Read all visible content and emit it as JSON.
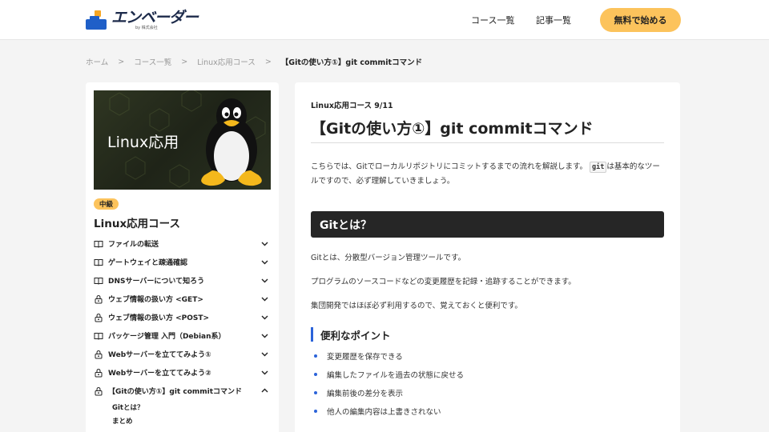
{
  "header": {
    "logo_name": "エンベーダー",
    "logo_sub": "by 株式会社",
    "nav": [
      "コース一覧",
      "記事一覧"
    ],
    "cta_label": "無料で始める"
  },
  "breadcrumb": {
    "items": [
      "ホーム",
      "コース一覧",
      "Linux応用コース"
    ],
    "separator": ">",
    "current": "【Gitの使い方①】git commitコマンド"
  },
  "sidebar": {
    "banner_title": "Linux応用",
    "level": "中級",
    "course_title": "Linux応用コース",
    "lessons": [
      {
        "label": "ファイルの転送",
        "icon": "book-icon"
      },
      {
        "label": "ゲートウェイと疎通確認",
        "icon": "book-icon"
      },
      {
        "label": "DNSサーバーについて知ろう",
        "icon": "book-icon"
      },
      {
        "label": "ウェブ情報の扱い方 <GET>",
        "icon": "lock-icon"
      },
      {
        "label": "ウェブ情報の扱い方 <POST>",
        "icon": "lock-icon"
      },
      {
        "label": "パッケージ管理 入門（Debian系）",
        "icon": "book-icon"
      },
      {
        "label": "Webサーバーを立ててみよう①",
        "icon": "lock-icon"
      },
      {
        "label": "Webサーバーを立ててみよう②",
        "icon": "lock-icon"
      },
      {
        "label": "【Gitの使い方①】git commitコマンド",
        "icon": "lock-icon",
        "expanded": true
      }
    ],
    "sub_items": [
      "Gitとは？",
      "まとめ"
    ]
  },
  "main": {
    "course_progress": "Linux応用コース  9/11",
    "title": "【Gitの使い方①】git commitコマンド",
    "intro_before": "こちらでは、Gitでローカルリポジトリにコミットするまでの流れを解説します。",
    "intro_code": "git",
    "intro_after": "は基本的なツールですので、必ず理解していきましょう。",
    "section_heading": "Gitとは？",
    "paragraphs": [
      "Gitとは、分散型バージョン管理ツールです。",
      "プログラムのソースコードなどの変更履歴を記録・追跡することができます。",
      "集団開発ではほぼ必ず利用するので、覚えておくと便利です。"
    ],
    "subheading": "便利なポイント",
    "bullets": [
      "変更履歴を保存できる",
      "編集したファイルを過去の状態に戻せる",
      "編集前後の差分を表示",
      "他人の編集内容は上書きされない"
    ]
  },
  "colors": {
    "accent_yellow": "#fcc35c",
    "accent_blue": "#2b63d9",
    "heading_bar": "#262626"
  }
}
